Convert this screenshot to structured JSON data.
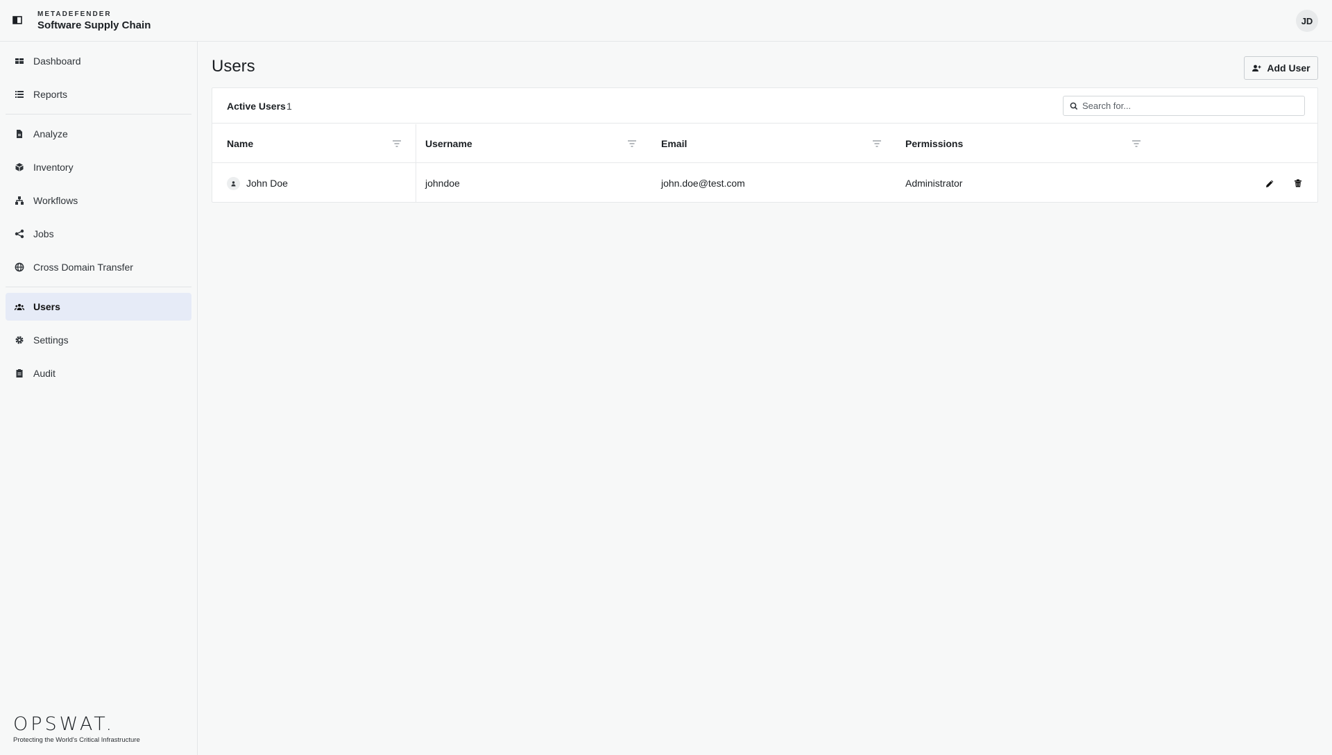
{
  "header": {
    "brand_small": "METADEFENDER",
    "brand_title": "Software Supply Chain",
    "avatar_initials": "JD"
  },
  "sidebar": {
    "items": [
      {
        "label": "Dashboard",
        "icon": "dashboard-icon"
      },
      {
        "label": "Reports",
        "icon": "list-icon"
      },
      {
        "label": "Analyze",
        "icon": "document-icon"
      },
      {
        "label": "Inventory",
        "icon": "box-icon"
      },
      {
        "label": "Workflows",
        "icon": "workflow-icon"
      },
      {
        "label": "Jobs",
        "icon": "share-icon"
      },
      {
        "label": "Cross Domain Transfer",
        "icon": "globe-icon"
      },
      {
        "label": "Users",
        "icon": "users-icon",
        "active": true
      },
      {
        "label": "Settings",
        "icon": "gear-icon"
      },
      {
        "label": "Audit",
        "icon": "clipboard-icon"
      }
    ],
    "footer": {
      "logo": "OPSWAT.",
      "tagline": "Protecting the World's Critical Infrastructure"
    }
  },
  "main": {
    "title": "Users",
    "add_button": "Add User",
    "card": {
      "active_label": "Active Users",
      "active_count": "1",
      "search_placeholder": "Search for..."
    },
    "table": {
      "columns": [
        "Name",
        "Username",
        "Email",
        "Permissions"
      ],
      "rows": [
        {
          "name": "John Doe",
          "username": "johndoe",
          "email": "john.doe@test.com",
          "permissions": "Administrator"
        }
      ]
    }
  },
  "colors": {
    "active_nav_bg": "#e6ebf7",
    "background": "#f7f8f8",
    "card_bg": "#ffffff"
  }
}
